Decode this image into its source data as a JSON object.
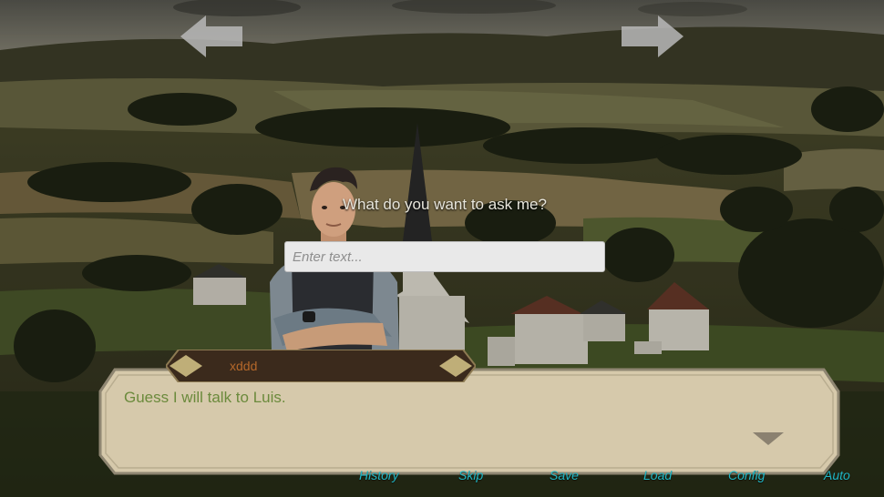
{
  "prompt": {
    "question": "What do you want to ask me?"
  },
  "input": {
    "placeholder": "Enter text...",
    "value": ""
  },
  "dialogue": {
    "speaker": "xddd",
    "text": "Guess I will talk to Luis."
  },
  "menu": {
    "history": "History",
    "skip": "Skip",
    "save": "Save",
    "load": "Load",
    "config": "Config",
    "auto": "Auto"
  },
  "colors": {
    "menu_text": "#1fb6c5",
    "dialog_text": "#6b8a3c",
    "speaker_text": "#b5682a",
    "dialog_bg": "#d8ccb0"
  },
  "icons": {
    "back": "left-arrow-icon",
    "forward": "right-arrow-icon",
    "next": "triangle-down-icon"
  }
}
